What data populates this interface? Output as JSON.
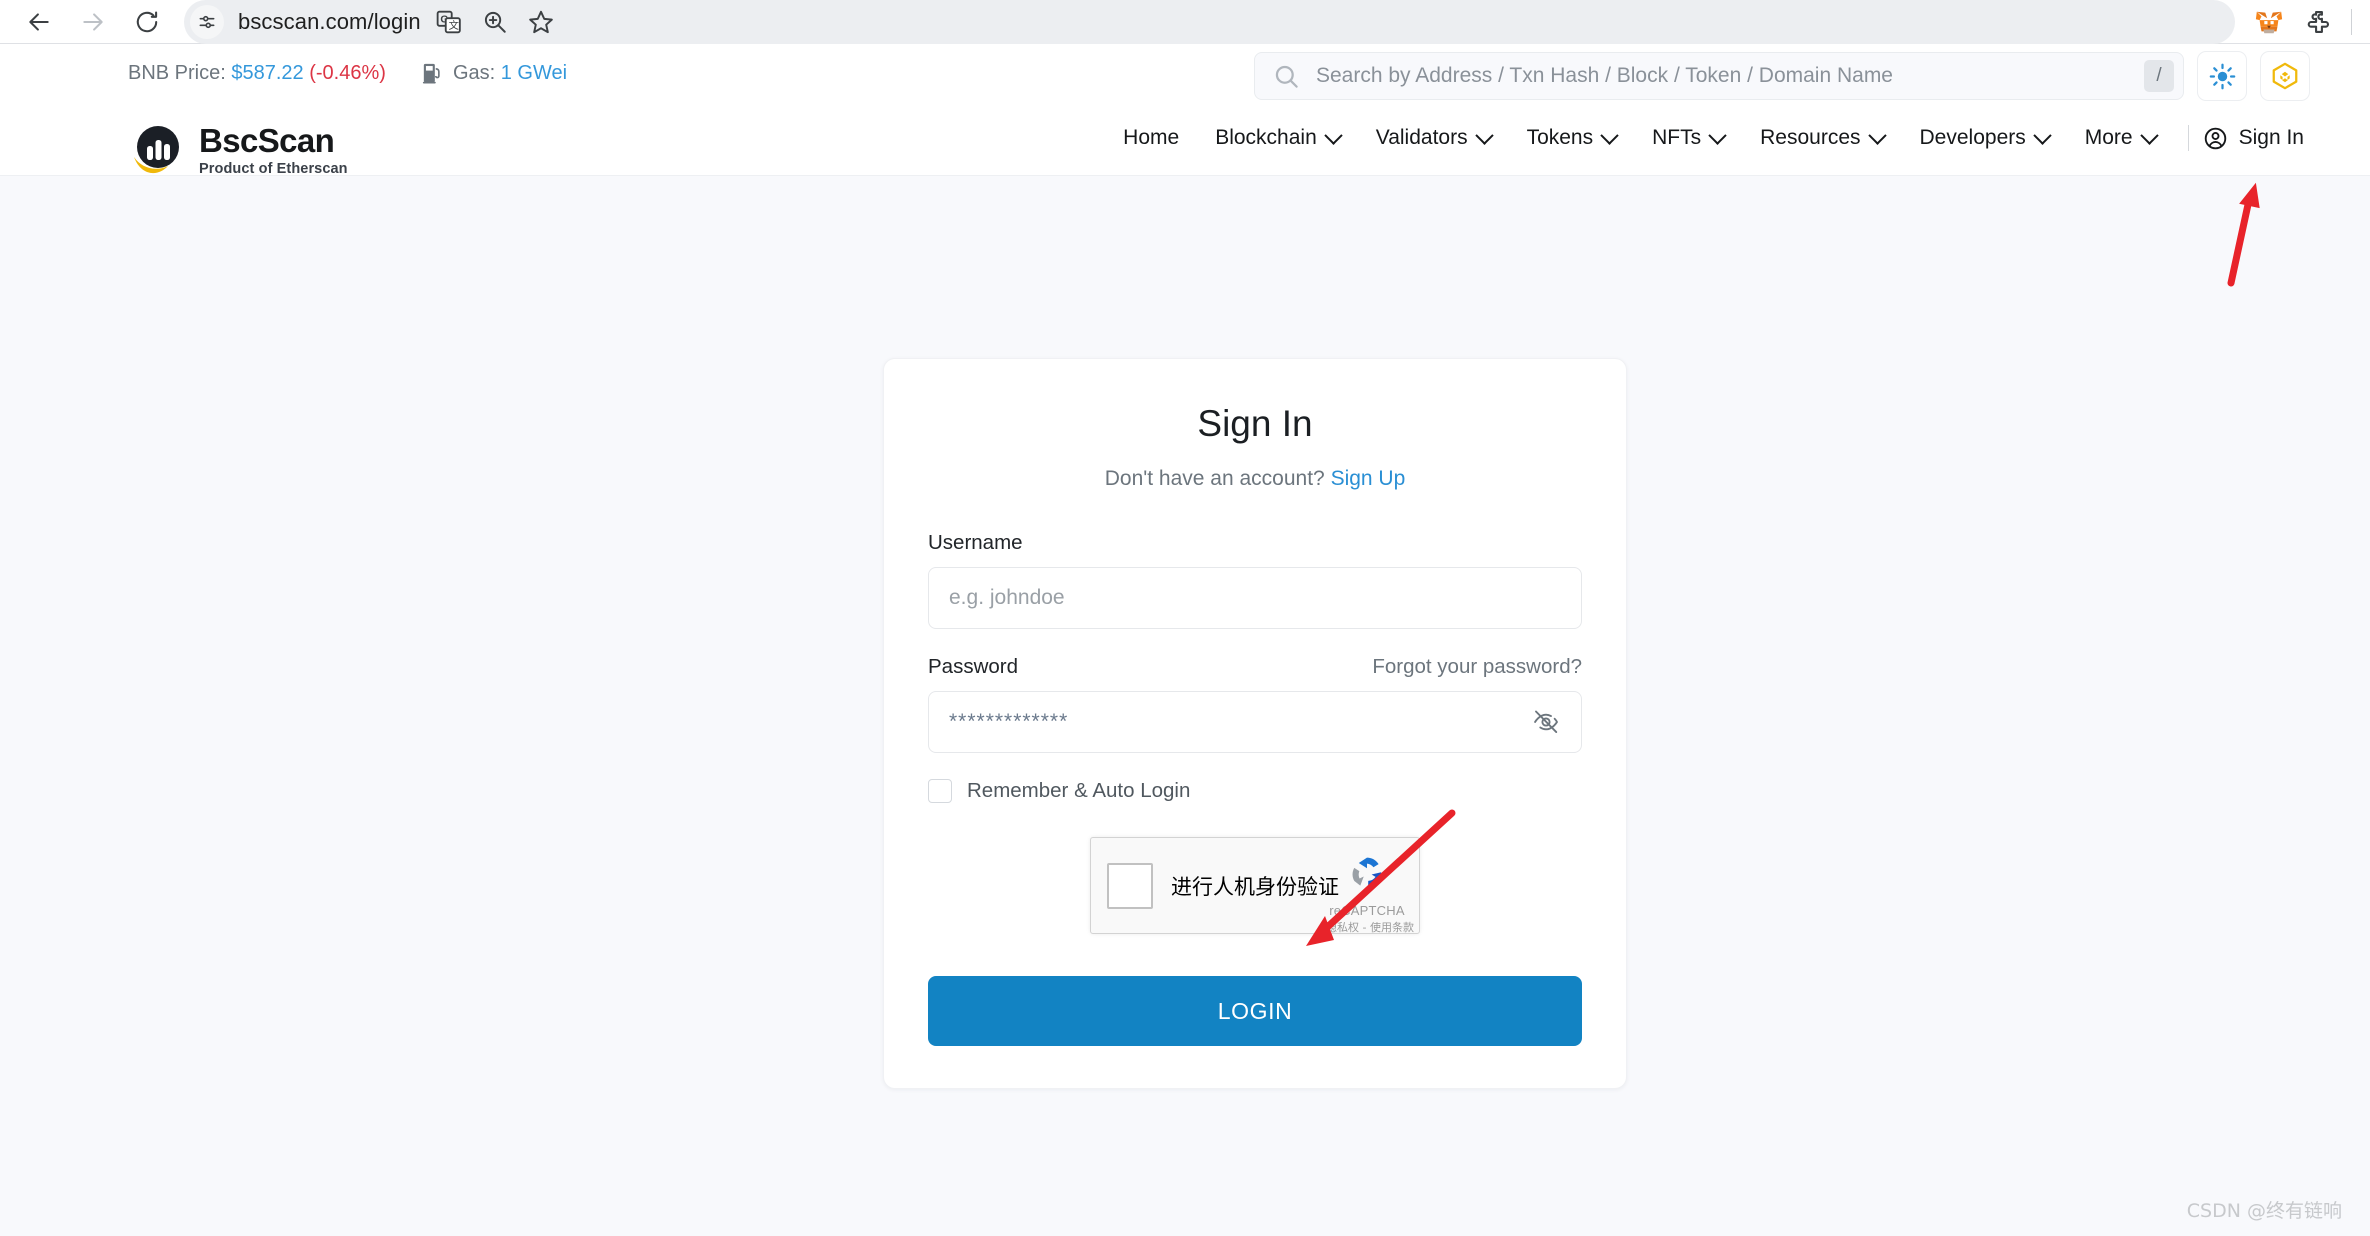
{
  "browser": {
    "url": "bscscan.com/login",
    "back_label": "Back",
    "forward_label": "Forward",
    "reload_label": "Reload",
    "site_info_label": "View site information",
    "translate_label": "Translate this page",
    "zoom_label": "Zoom",
    "bookmark_label": "Bookmark this tab",
    "metamask_label": "MetaMask",
    "extensions_label": "Extensions"
  },
  "ticker": {
    "price_label": "BNB Price:",
    "price_value": "$587.22",
    "price_change": "(-0.46%)",
    "gas_icon_label": "gas-pump-icon",
    "gas_label": "Gas:",
    "gas_value": "1 GWei"
  },
  "search": {
    "placeholder": "Search by Address / Txn Hash / Block / Token / Domain Name",
    "value": "",
    "shortcut_badge": "/",
    "theme_toggle_label": "Light mode",
    "chain_selector_label": "BNB Chain"
  },
  "brand": {
    "title": "BscScan",
    "subtitle": "Product of Etherscan"
  },
  "nav": {
    "items": [
      {
        "label": "Home",
        "has_dropdown": false
      },
      {
        "label": "Blockchain",
        "has_dropdown": true
      },
      {
        "label": "Validators",
        "has_dropdown": true
      },
      {
        "label": "Tokens",
        "has_dropdown": true
      },
      {
        "label": "NFTs",
        "has_dropdown": true
      },
      {
        "label": "Resources",
        "has_dropdown": true
      },
      {
        "label": "Developers",
        "has_dropdown": true
      },
      {
        "label": "More",
        "has_dropdown": true
      }
    ],
    "signin_label": "Sign In"
  },
  "login": {
    "title": "Sign In",
    "subtitle_text": "Don't have an account?",
    "signup_link": "Sign Up",
    "username_label": "Username",
    "username_placeholder": "e.g. johndoe",
    "username_value": "",
    "password_label": "Password",
    "password_placeholder": "*************",
    "password_value": "",
    "forgot_link": "Forgot your password?",
    "toggle_password_label": "eye-off-icon",
    "remember_label": "Remember & Auto Login",
    "remember_checked": false,
    "submit_label": "LOGIN"
  },
  "recaptcha": {
    "checkbox_label": "进行人机身份验证",
    "brand_name": "reCAPTCHA",
    "terms": "隐私权 - 使用条款",
    "checked": false
  },
  "annotations": {
    "arrow_color": "#e8232a",
    "arrow_signin_target": "Sign In",
    "arrow_recaptcha_target": "进行人机身份验证"
  },
  "watermark": {
    "text": "CSDN @终有链响"
  }
}
